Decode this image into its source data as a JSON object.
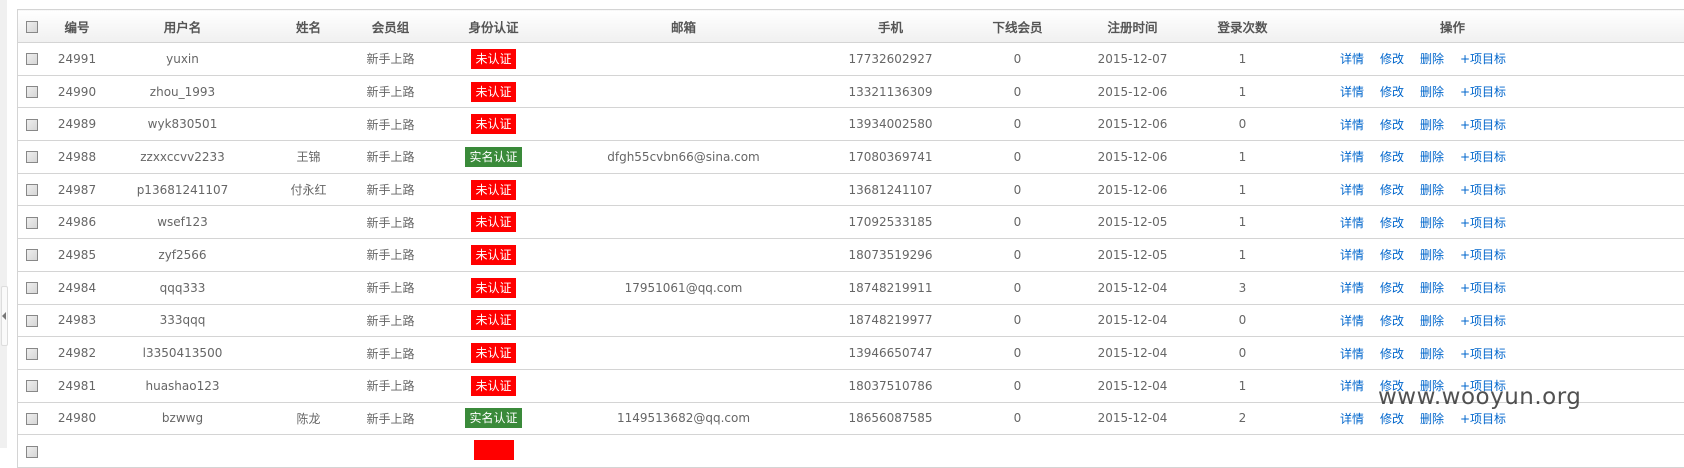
{
  "headers": [
    "编号",
    "用户名",
    "姓名",
    "会员组",
    "身份认证",
    "邮箱",
    "手机",
    "下线会员",
    "注册时间",
    "登录次数",
    "操作"
  ],
  "actions": [
    "详情",
    "修改",
    "删除",
    "+项目标"
  ],
  "colors": {
    "unverified": "#ff0000",
    "verified": "#3a8a3a",
    "link": "#0066cc"
  },
  "rows": [
    {
      "id": "24991",
      "user": "yuxin",
      "name": "",
      "group": "新手上路",
      "auth": "未认证",
      "verified": false,
      "email": "",
      "phone": "17732602927",
      "sub": "0",
      "reg": "2015-12-07",
      "logins": "1"
    },
    {
      "id": "24990",
      "user": "zhou_1993",
      "name": "",
      "group": "新手上路",
      "auth": "未认证",
      "verified": false,
      "email": "",
      "phone": "13321136309",
      "sub": "0",
      "reg": "2015-12-06",
      "logins": "1"
    },
    {
      "id": "24989",
      "user": "wyk830501",
      "name": "",
      "group": "新手上路",
      "auth": "未认证",
      "verified": false,
      "email": "",
      "phone": "13934002580",
      "sub": "0",
      "reg": "2015-12-06",
      "logins": "0"
    },
    {
      "id": "24988",
      "user": "zzxxccvv2233",
      "name": "王锦",
      "group": "新手上路",
      "auth": "实名认证",
      "verified": true,
      "email": "dfgh55cvbn66@sina.com",
      "phone": "17080369741",
      "sub": "0",
      "reg": "2015-12-06",
      "logins": "1"
    },
    {
      "id": "24987",
      "user": "p13681241107",
      "name": "付永红",
      "group": "新手上路",
      "auth": "未认证",
      "verified": false,
      "email": "",
      "phone": "13681241107",
      "sub": "0",
      "reg": "2015-12-06",
      "logins": "1"
    },
    {
      "id": "24986",
      "user": "wsef123",
      "name": "",
      "group": "新手上路",
      "auth": "未认证",
      "verified": false,
      "email": "",
      "phone": "17092533185",
      "sub": "0",
      "reg": "2015-12-05",
      "logins": "1"
    },
    {
      "id": "24985",
      "user": "zyf2566",
      "name": "",
      "group": "新手上路",
      "auth": "未认证",
      "verified": false,
      "email": "",
      "phone": "18073519296",
      "sub": "0",
      "reg": "2015-12-05",
      "logins": "1"
    },
    {
      "id": "24984",
      "user": "qqq333",
      "name": "",
      "group": "新手上路",
      "auth": "未认证",
      "verified": false,
      "email": "17951061@qq.com",
      "phone": "18748219911",
      "sub": "0",
      "reg": "2015-12-04",
      "logins": "3"
    },
    {
      "id": "24983",
      "user": "333qqq",
      "name": "",
      "group": "新手上路",
      "auth": "未认证",
      "verified": false,
      "email": "",
      "phone": "18748219977",
      "sub": "0",
      "reg": "2015-12-04",
      "logins": "0"
    },
    {
      "id": "24982",
      "user": "l3350413500",
      "name": "",
      "group": "新手上路",
      "auth": "未认证",
      "verified": false,
      "email": "",
      "phone": "13946650747",
      "sub": "0",
      "reg": "2015-12-04",
      "logins": "0"
    },
    {
      "id": "24981",
      "user": "huashao123",
      "name": "",
      "group": "新手上路",
      "auth": "未认证",
      "verified": false,
      "email": "",
      "phone": "18037510786",
      "sub": "0",
      "reg": "2015-12-04",
      "logins": "1"
    },
    {
      "id": "24980",
      "user": "bzwwg",
      "name": "陈龙",
      "group": "新手上路",
      "auth": "实名认证",
      "verified": true,
      "email": "1149513682@qq.com",
      "phone": "18656087585",
      "sub": "0",
      "reg": "2015-12-04",
      "logins": "2"
    }
  ],
  "watermark": "www.wooyun.org"
}
